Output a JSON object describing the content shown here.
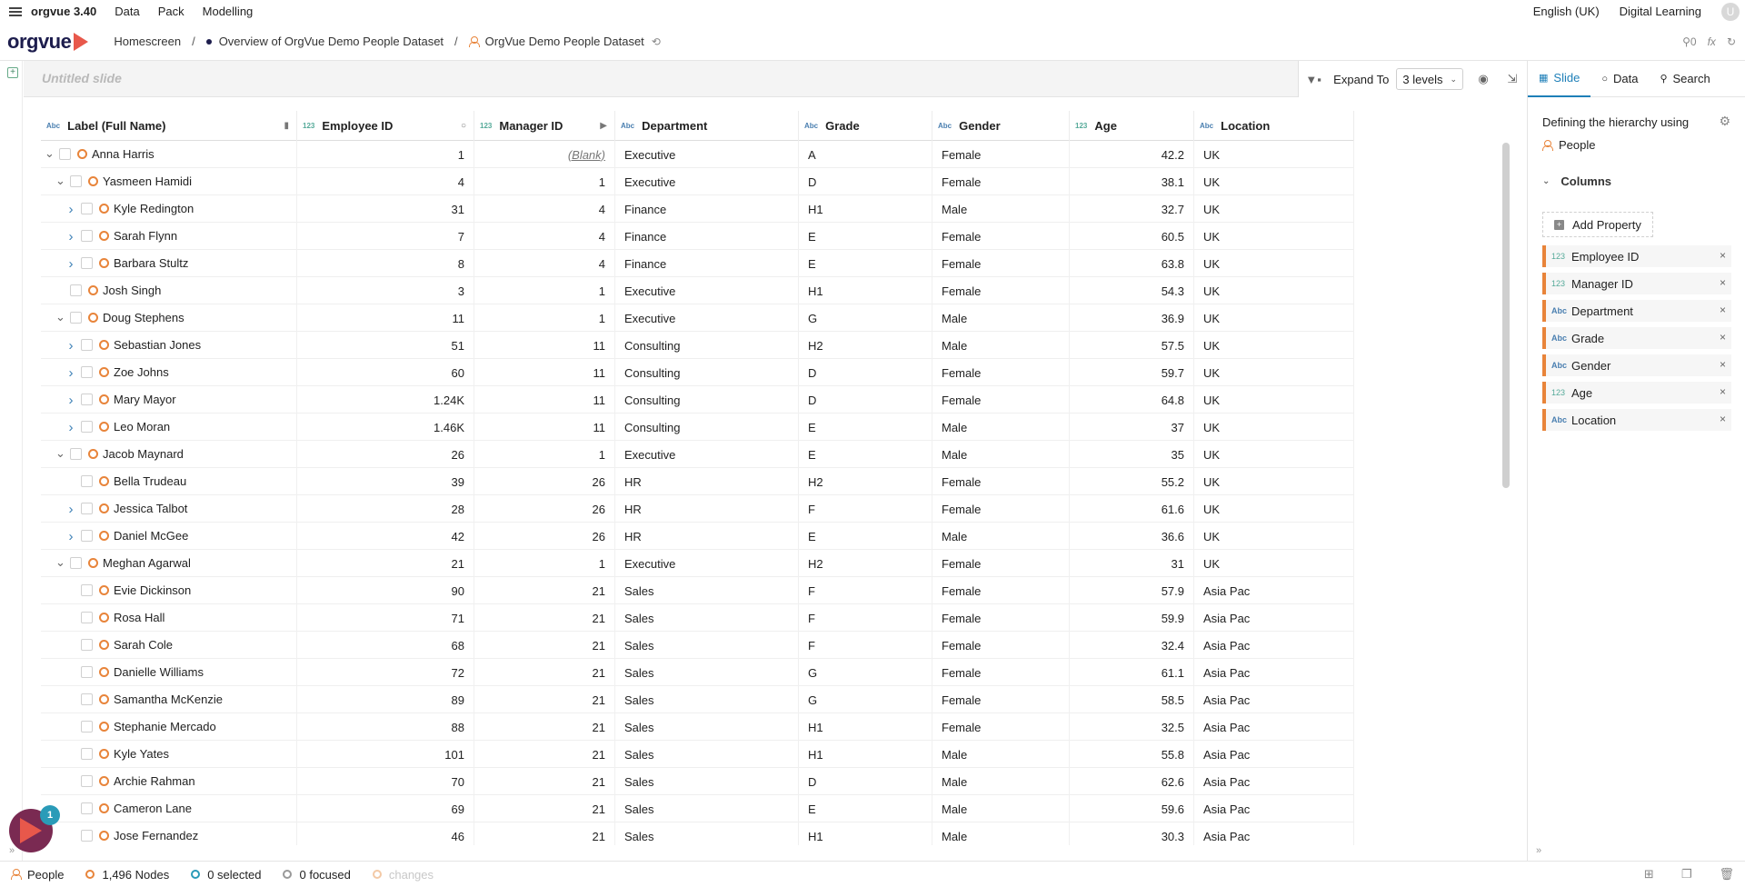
{
  "menu": {
    "app_version": "orgvue 3.40",
    "items": [
      "Data",
      "Pack",
      "Modelling"
    ],
    "language": "English (UK)",
    "tenant": "Digital Learning",
    "avatar_initial": "U"
  },
  "header": {
    "logo": "orgvue",
    "breadcrumb": [
      "Homescreen",
      "Overview of OrgVue Demo People Dataset",
      "OrgVue Demo People Dataset"
    ],
    "people_count": "0",
    "fx": "fx"
  },
  "slide": {
    "title": "Untitled slide",
    "expand_label": "Expand To",
    "expand_value": "3 levels"
  },
  "right_panel": {
    "tabs": [
      "Slide",
      "Data",
      "Search"
    ],
    "heading": "Defining the hierarchy using",
    "dataset": "People",
    "columns_label": "Columns",
    "add_property": "Add Property",
    "properties": [
      {
        "type": "123",
        "name": "Employee ID"
      },
      {
        "type": "123",
        "name": "Manager ID"
      },
      {
        "type": "Abc",
        "name": "Department"
      },
      {
        "type": "Abc",
        "name": "Grade"
      },
      {
        "type": "Abc",
        "name": "Gender"
      },
      {
        "type": "123",
        "name": "Age"
      },
      {
        "type": "Abc",
        "name": "Location"
      }
    ]
  },
  "grid": {
    "columns": [
      {
        "type": "Abc",
        "name": "Label (Full Name)"
      },
      {
        "type": "123",
        "name": "Employee ID"
      },
      {
        "type": "123",
        "name": "Manager ID"
      },
      {
        "type": "Abc",
        "name": "Department"
      },
      {
        "type": "Abc",
        "name": "Grade"
      },
      {
        "type": "Abc",
        "name": "Gender"
      },
      {
        "type": "123",
        "name": "Age"
      },
      {
        "type": "Abc",
        "name": "Location"
      }
    ],
    "rows": [
      {
        "depth": 0,
        "exp": "down",
        "name": "Anna Harris",
        "id": "1",
        "mgr": "(Blank)",
        "dept": "Executive",
        "grade": "A",
        "gender": "Female",
        "age": "42.2",
        "loc": "UK"
      },
      {
        "depth": 1,
        "exp": "down",
        "name": "Yasmeen Hamidi",
        "id": "4",
        "mgr": "1",
        "dept": "Executive",
        "grade": "D",
        "gender": "Female",
        "age": "38.1",
        "loc": "UK"
      },
      {
        "depth": 2,
        "exp": "right",
        "name": "Kyle Redington",
        "id": "31",
        "mgr": "4",
        "dept": "Finance",
        "grade": "H1",
        "gender": "Male",
        "age": "32.7",
        "loc": "UK"
      },
      {
        "depth": 2,
        "exp": "right",
        "name": "Sarah Flynn",
        "id": "7",
        "mgr": "4",
        "dept": "Finance",
        "grade": "E",
        "gender": "Female",
        "age": "60.5",
        "loc": "UK"
      },
      {
        "depth": 2,
        "exp": "right",
        "name": "Barbara Stultz",
        "id": "8",
        "mgr": "4",
        "dept": "Finance",
        "grade": "E",
        "gender": "Female",
        "age": "63.8",
        "loc": "UK"
      },
      {
        "depth": 1,
        "exp": "",
        "name": "Josh Singh",
        "id": "3",
        "mgr": "1",
        "dept": "Executive",
        "grade": "H1",
        "gender": "Female",
        "age": "54.3",
        "loc": "UK"
      },
      {
        "depth": 1,
        "exp": "down",
        "name": "Doug Stephens",
        "id": "11",
        "mgr": "1",
        "dept": "Executive",
        "grade": "G",
        "gender": "Male",
        "age": "36.9",
        "loc": "UK"
      },
      {
        "depth": 2,
        "exp": "right",
        "name": "Sebastian Jones",
        "id": "51",
        "mgr": "11",
        "dept": "Consulting",
        "grade": "H2",
        "gender": "Male",
        "age": "57.5",
        "loc": "UK"
      },
      {
        "depth": 2,
        "exp": "right",
        "name": "Zoe Johns",
        "id": "60",
        "mgr": "11",
        "dept": "Consulting",
        "grade": "D",
        "gender": "Female",
        "age": "59.7",
        "loc": "UK"
      },
      {
        "depth": 2,
        "exp": "right",
        "name": "Mary Mayor",
        "id": "1.24K",
        "mgr": "11",
        "dept": "Consulting",
        "grade": "D",
        "gender": "Female",
        "age": "64.8",
        "loc": "UK"
      },
      {
        "depth": 2,
        "exp": "right",
        "name": "Leo Moran",
        "id": "1.46K",
        "mgr": "11",
        "dept": "Consulting",
        "grade": "E",
        "gender": "Male",
        "age": "37",
        "loc": "UK"
      },
      {
        "depth": 1,
        "exp": "down",
        "name": "Jacob Maynard",
        "id": "26",
        "mgr": "1",
        "dept": "Executive",
        "grade": "E",
        "gender": "Male",
        "age": "35",
        "loc": "UK"
      },
      {
        "depth": 2,
        "exp": "",
        "name": "Bella Trudeau",
        "id": "39",
        "mgr": "26",
        "dept": "HR",
        "grade": "H2",
        "gender": "Female",
        "age": "55.2",
        "loc": "UK"
      },
      {
        "depth": 2,
        "exp": "right",
        "name": "Jessica Talbot",
        "id": "28",
        "mgr": "26",
        "dept": "HR",
        "grade": "F",
        "gender": "Female",
        "age": "61.6",
        "loc": "UK"
      },
      {
        "depth": 2,
        "exp": "right",
        "name": "Daniel McGee",
        "id": "42",
        "mgr": "26",
        "dept": "HR",
        "grade": "E",
        "gender": "Male",
        "age": "36.6",
        "loc": "UK"
      },
      {
        "depth": 1,
        "exp": "down",
        "name": "Meghan Agarwal",
        "id": "21",
        "mgr": "1",
        "dept": "Executive",
        "grade": "H2",
        "gender": "Female",
        "age": "31",
        "loc": "UK"
      },
      {
        "depth": 2,
        "exp": "",
        "name": "Evie Dickinson",
        "id": "90",
        "mgr": "21",
        "dept": "Sales",
        "grade": "F",
        "gender": "Female",
        "age": "57.9",
        "loc": "Asia Pac"
      },
      {
        "depth": 2,
        "exp": "",
        "name": "Rosa Hall",
        "id": "71",
        "mgr": "21",
        "dept": "Sales",
        "grade": "F",
        "gender": "Female",
        "age": "59.9",
        "loc": "Asia Pac"
      },
      {
        "depth": 2,
        "exp": "",
        "name": "Sarah Cole",
        "id": "68",
        "mgr": "21",
        "dept": "Sales",
        "grade": "F",
        "gender": "Female",
        "age": "32.4",
        "loc": "Asia Pac"
      },
      {
        "depth": 2,
        "exp": "",
        "name": "Danielle Williams",
        "id": "72",
        "mgr": "21",
        "dept": "Sales",
        "grade": "G",
        "gender": "Female",
        "age": "61.1",
        "loc": "Asia Pac"
      },
      {
        "depth": 2,
        "exp": "",
        "name": "Samantha McKenzie",
        "id": "89",
        "mgr": "21",
        "dept": "Sales",
        "grade": "G",
        "gender": "Female",
        "age": "58.5",
        "loc": "Asia Pac"
      },
      {
        "depth": 2,
        "exp": "",
        "name": "Stephanie Mercado",
        "id": "88",
        "mgr": "21",
        "dept": "Sales",
        "grade": "H1",
        "gender": "Female",
        "age": "32.5",
        "loc": "Asia Pac"
      },
      {
        "depth": 2,
        "exp": "",
        "name": "Kyle Yates",
        "id": "101",
        "mgr": "21",
        "dept": "Sales",
        "grade": "H1",
        "gender": "Male",
        "age": "55.8",
        "loc": "Asia Pac"
      },
      {
        "depth": 2,
        "exp": "",
        "name": "Archie Rahman",
        "id": "70",
        "mgr": "21",
        "dept": "Sales",
        "grade": "D",
        "gender": "Male",
        "age": "62.6",
        "loc": "Asia Pac"
      },
      {
        "depth": 2,
        "exp": "",
        "name": "Cameron Lane",
        "id": "69",
        "mgr": "21",
        "dept": "Sales",
        "grade": "E",
        "gender": "Male",
        "age": "59.6",
        "loc": "Asia Pac"
      },
      {
        "depth": 2,
        "exp": "",
        "name": "Jose Fernandez",
        "id": "46",
        "mgr": "21",
        "dept": "Sales",
        "grade": "H1",
        "gender": "Male",
        "age": "30.3",
        "loc": "Asia Pac"
      }
    ]
  },
  "status": {
    "dataset": "People",
    "nodes": "1,496 Nodes",
    "selected": "0 selected",
    "focused": "0 focused",
    "changes": "changes",
    "notification_count": "1"
  }
}
